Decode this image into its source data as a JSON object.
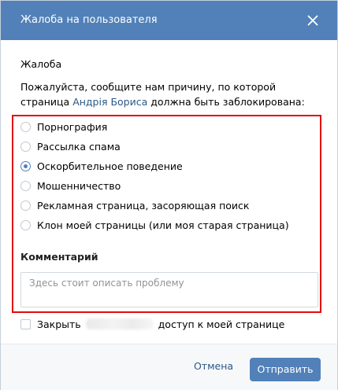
{
  "dialog": {
    "title": "Жалоба на пользователя",
    "section_title": "Жалоба",
    "intro_before": "Пожалуйста, сообщите нам причину, по которой страница ",
    "intro_link": "Андрія Бориса",
    "intro_after": " должна быть заблокирована:",
    "reasons": [
      {
        "label": "Порнография",
        "checked": false
      },
      {
        "label": "Рассылка спама",
        "checked": false
      },
      {
        "label": "Оскорбительное поведение",
        "checked": true
      },
      {
        "label": "Мошенничество",
        "checked": false
      },
      {
        "label": "Рекламная страница, засоряющая поиск",
        "checked": false
      },
      {
        "label": "Клон моей страницы (или моя старая страница)",
        "checked": false
      }
    ],
    "comment_title": "Комментарий",
    "comment_placeholder": "Здесь стоит описать проблему",
    "close_access_before": "Закрыть",
    "close_access_after": "доступ к моей странице",
    "cancel_label": "Отмена",
    "submit_label": "Отправить"
  },
  "colors": {
    "header": "#5181b8",
    "link": "#2a5885",
    "highlight_frame": "#e30b0b"
  }
}
